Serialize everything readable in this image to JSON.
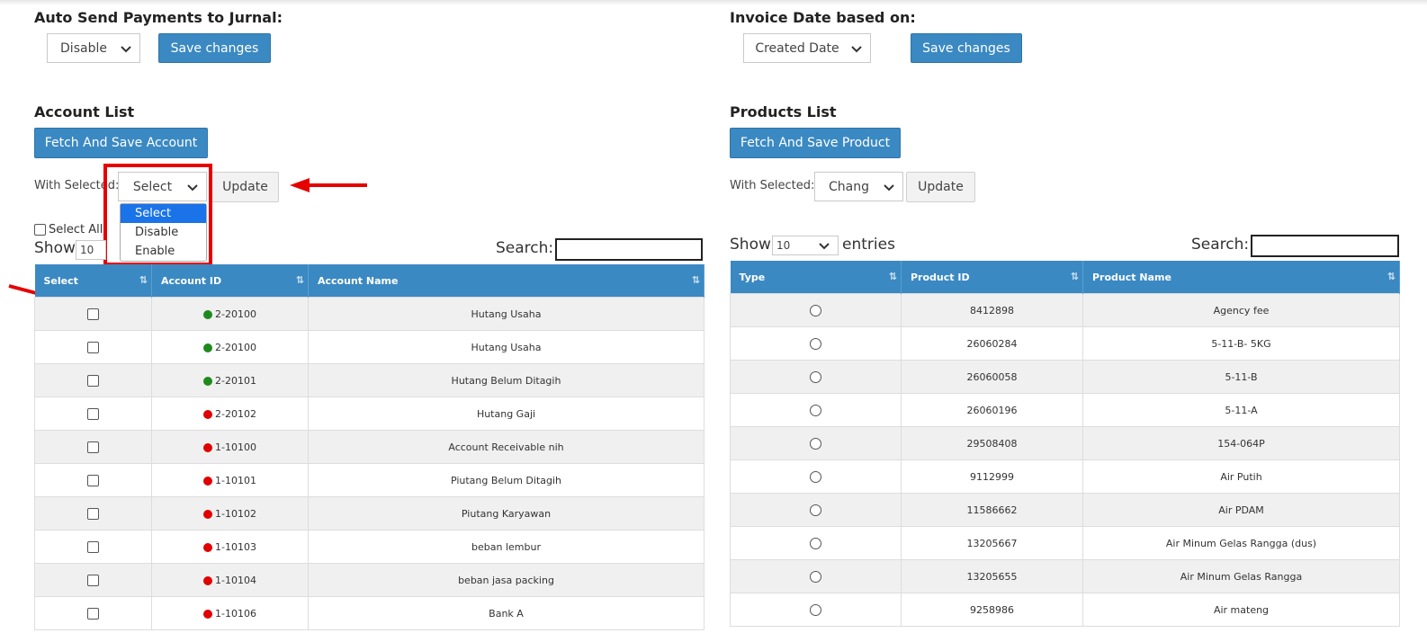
{
  "left": {
    "auto_send_title": "Auto Send Payments to Jurnal:",
    "auto_send_value": "Disable",
    "save_label": "Save changes",
    "account_list_title": "Account List",
    "fetch_label": "Fetch And Save Account",
    "with_selected_label": "With Selected:",
    "with_selected_value": "Select",
    "update_label": "Update",
    "dropdown_options": [
      "Select",
      "Disable",
      "Enable"
    ],
    "select_all_label": "Select All",
    "show_label": "Show",
    "show_value": "10",
    "search_label": "Search:",
    "columns": [
      "Select",
      "Account ID",
      "Account Name"
    ],
    "rows": [
      {
        "status": "green",
        "id": "2-20100",
        "name": "Hutang Usaha"
      },
      {
        "status": "green",
        "id": "2-20100",
        "name": "Hutang Usaha"
      },
      {
        "status": "green",
        "id": "2-20101",
        "name": "Hutang Belum Ditagih"
      },
      {
        "status": "red",
        "id": "2-20102",
        "name": "Hutang Gaji"
      },
      {
        "status": "red",
        "id": "1-10100",
        "name": "Account Receivable nih"
      },
      {
        "status": "red",
        "id": "1-10101",
        "name": "Piutang Belum Ditagih"
      },
      {
        "status": "red",
        "id": "1-10102",
        "name": "Piutang Karyawan"
      },
      {
        "status": "red",
        "id": "1-10103",
        "name": "beban lembur"
      },
      {
        "status": "red",
        "id": "1-10104",
        "name": "beban jasa packing"
      },
      {
        "status": "red",
        "id": "1-10106",
        "name": "Bank A"
      }
    ]
  },
  "right": {
    "invoice_date_title": "Invoice Date based on:",
    "invoice_date_value": "Created Date",
    "save_label": "Save changes",
    "products_list_title": "Products List",
    "fetch_label": "Fetch And Save Product",
    "with_selected_label": "With Selected:",
    "with_selected_value": "Chang",
    "update_label": "Update",
    "show_label": "Show",
    "show_value": "10",
    "entries_label": "entries",
    "search_label": "Search:",
    "columns": [
      "Type",
      "Product ID",
      "Product Name"
    ],
    "rows": [
      {
        "id": "8412898",
        "name": "Agency fee"
      },
      {
        "id": "26060284",
        "name": "5-11-B- 5KG"
      },
      {
        "id": "26060058",
        "name": "5-11-B"
      },
      {
        "id": "26060196",
        "name": "5-11-A"
      },
      {
        "id": "29508408",
        "name": "154-064P"
      },
      {
        "id": "9112999",
        "name": "Air Putih"
      },
      {
        "id": "11586662",
        "name": "Air PDAM"
      },
      {
        "id": "13205667",
        "name": "Air Minum Gelas Rangga (dus)"
      },
      {
        "id": "13205655",
        "name": "Air Minum Gelas Rangga"
      },
      {
        "id": "9258986",
        "name": "Air mateng"
      }
    ]
  },
  "colors": {
    "accent": "#3b89c2",
    "green": "#1e8a1e",
    "red": "#e00000",
    "annotation": "#e60000"
  }
}
